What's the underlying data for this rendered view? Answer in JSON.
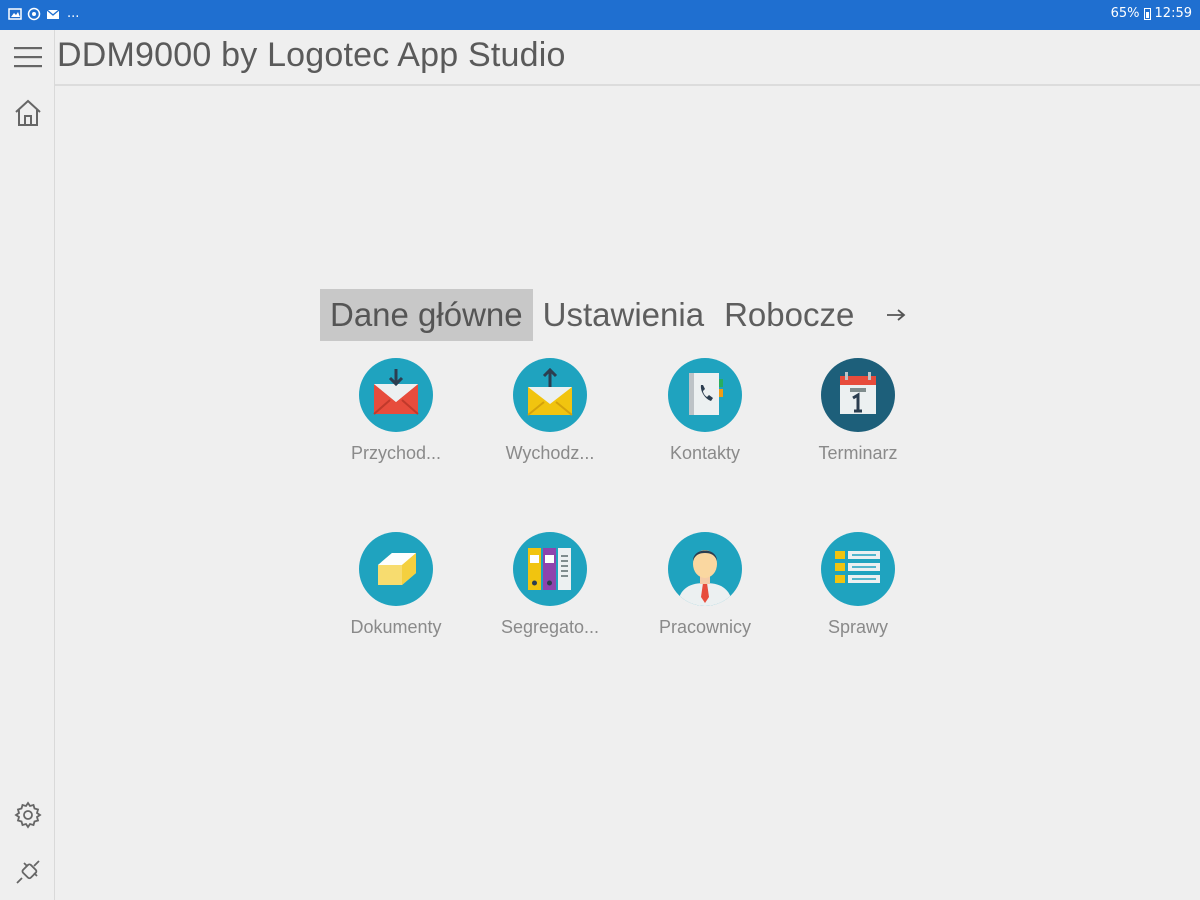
{
  "status_bar": {
    "left_icons": [
      "image-icon",
      "sync-icon",
      "mail-icon"
    ],
    "left_overflow": "...",
    "battery_percent": "65%",
    "time": "12:59"
  },
  "header": {
    "title": "DDM9000 by Logotec App Studio"
  },
  "sidebar": {
    "top_icons": [
      "hamburger-menu-icon",
      "home-icon"
    ],
    "bottom_icons": [
      "gear-icon",
      "plug-icon"
    ]
  },
  "tabs": [
    {
      "label": "Dane główne",
      "active": true
    },
    {
      "label": "Ustawienia",
      "active": false
    },
    {
      "label": "Robocze",
      "active": false
    }
  ],
  "tab_next_icon": "arrow-right-icon",
  "tiles": [
    {
      "label": "Przychod...",
      "icon": "incoming-mail-icon"
    },
    {
      "label": "Wychodz...",
      "icon": "outgoing-mail-icon"
    },
    {
      "label": "Kontakty",
      "icon": "contacts-book-icon"
    },
    {
      "label": "Terminarz",
      "icon": "calendar-icon"
    },
    {
      "label": "Dokumenty",
      "icon": "document-box-icon"
    },
    {
      "label": "Segregato...",
      "icon": "binders-icon"
    },
    {
      "label": "Pracownicy",
      "icon": "employee-icon"
    },
    {
      "label": "Sprawy",
      "icon": "cases-list-icon"
    }
  ],
  "colors": {
    "status_bar": "#1f6fd0",
    "background": "#efefef",
    "tile_circle": "#1fa3bf",
    "active_tab": "#c8c8c8"
  }
}
